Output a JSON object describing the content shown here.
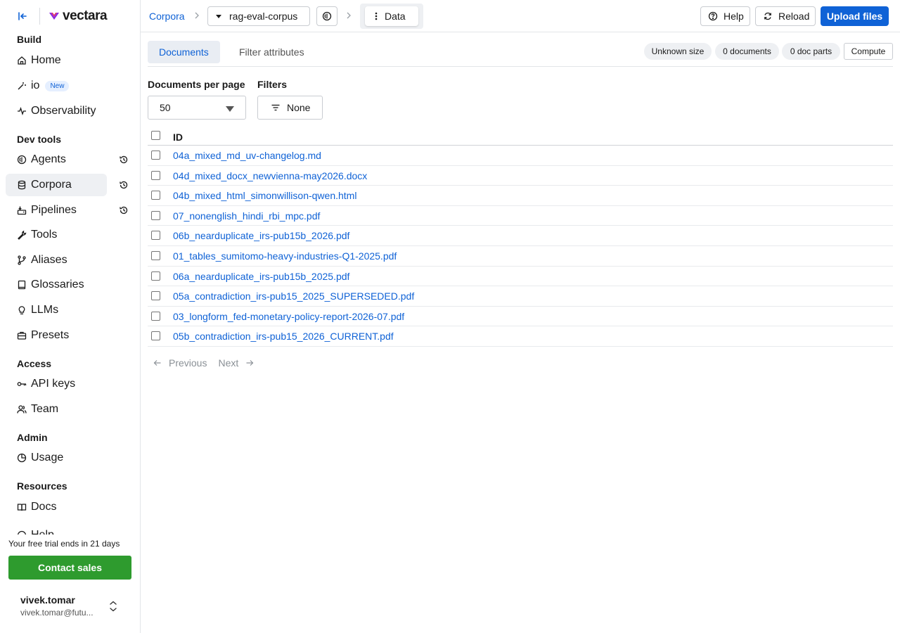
{
  "app": {
    "logo_text": "vectara"
  },
  "sidebar": {
    "sections": {
      "build": "Build",
      "dev_tools": "Dev tools",
      "access": "Access",
      "admin": "Admin",
      "resources": "Resources"
    },
    "items": {
      "home": "Home",
      "io": "io",
      "io_badge": "New",
      "observability": "Observability",
      "agents": "Agents",
      "corpora": "Corpora",
      "pipelines": "Pipelines",
      "tools": "Tools",
      "aliases": "Aliases",
      "glossaries": "Glossaries",
      "llms": "LLMs",
      "presets": "Presets",
      "api_keys": "API keys",
      "team": "Team",
      "usage": "Usage",
      "docs": "Docs",
      "help_partial": "Help"
    },
    "trial_text": "Your free trial ends in 21 days",
    "contact_sales": "Contact sales",
    "user": {
      "name": "vivek.tomar",
      "email": "vivek.tomar@futu..."
    }
  },
  "header": {
    "breadcrumb_root": "Corpora",
    "corpus_name": "rag-eval-corpus",
    "current_view": "Data",
    "help": "Help",
    "reload": "Reload",
    "upload": "Upload files"
  },
  "tabs": {
    "documents": "Documents",
    "filter_attributes": "Filter attributes"
  },
  "stats": {
    "size": "Unknown size",
    "documents": "0 documents",
    "doc_parts": "0 doc parts",
    "compute": "Compute"
  },
  "controls": {
    "per_page_label": "Documents per page",
    "per_page_value": "50",
    "filters_label": "Filters",
    "filters_value": "None"
  },
  "table": {
    "id_header": "ID",
    "rows": [
      "04a_mixed_md_uv-changelog.md",
      "04d_mixed_docx_newvienna-may2026.docx",
      "04b_mixed_html_simonwillison-qwen.html",
      "07_nonenglish_hindi_rbi_mpc.pdf",
      "06b_nearduplicate_irs-pub15b_2026.pdf",
      "01_tables_sumitomo-heavy-industries-Q1-2025.pdf",
      "06a_nearduplicate_irs-pub15b_2025.pdf",
      "05a_contradiction_irs-pub15_2025_SUPERSEDED.pdf",
      "03_longform_fed-monetary-policy-report-2026-07.pdf",
      "05b_contradiction_irs-pub15_2026_CURRENT.pdf"
    ]
  },
  "pager": {
    "previous": "Previous",
    "next": "Next"
  },
  "colors": {
    "accent": "#0f62d6",
    "contact": "#2e9b2e"
  }
}
